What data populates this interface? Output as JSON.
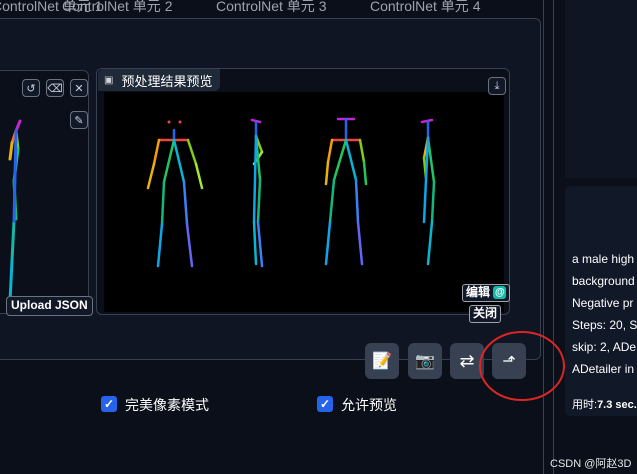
{
  "tabs": [
    "ControlNet 单元 1",
    "ControlNet 单元 2",
    "ControlNet 单元 3",
    "ControlNet 单元 4"
  ],
  "left_image": {
    "buttons": [
      {
        "name": "undo-icon",
        "glyph": "↺"
      },
      {
        "name": "eraser-icon",
        "glyph": "⌫"
      },
      {
        "name": "close-icon",
        "glyph": "✕"
      }
    ],
    "pen_glyph": "✎",
    "upload_json_label": "Upload JSON"
  },
  "preview": {
    "label": "预处理结果预览",
    "download_glyph": "⤓",
    "edit_label": "编辑",
    "close_label": "关闭"
  },
  "toolbar": [
    {
      "name": "notepad-icon",
      "glyph": "📝"
    },
    {
      "name": "camera-icon",
      "glyph": "📷"
    },
    {
      "name": "swap-icon",
      "glyph": "⇄"
    },
    {
      "name": "send-up-icon",
      "glyph": "⬏"
    }
  ],
  "options": {
    "pixel_perfect_label": "完美像素模式",
    "allow_preview_label": "允许预览",
    "pixel_perfect_checked": true,
    "allow_preview_checked": true
  },
  "info": {
    "lines": [
      "a male high",
      "background",
      "Negative pr",
      "Steps: 20, S",
      "skip: 2, ADe",
      "ADetailer in"
    ],
    "time_label": "用时:",
    "time_value": "7.3 sec."
  },
  "watermark": "CSDN @阿赵3D",
  "colors": {
    "bg": "#0b0f19",
    "accent_blue": "#2563eb",
    "annotation_red": "#dc2626"
  }
}
